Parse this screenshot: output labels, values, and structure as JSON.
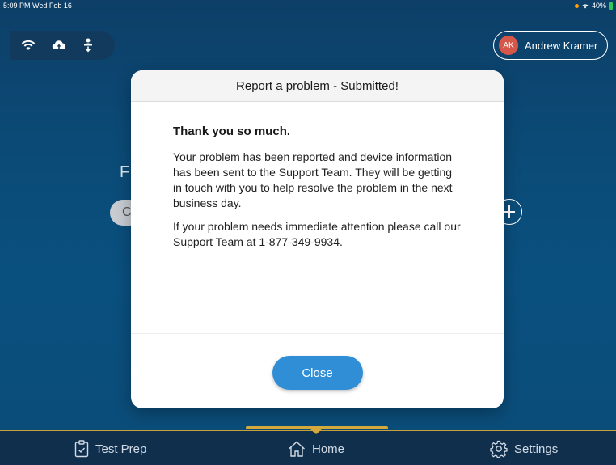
{
  "status_bar": {
    "time": "5:09 PM  Wed Feb 16",
    "battery": "40%"
  },
  "connectivity": {
    "icons": [
      "wifi-icon",
      "cloud-upload-icon",
      "person-download-icon"
    ]
  },
  "user": {
    "initials": "AK",
    "name": "Andrew Kramer",
    "avatar_color": "#d4574a"
  },
  "background": {
    "partial_letter": "F",
    "partial_button": "C"
  },
  "modal": {
    "title": "Report a problem - Submitted!",
    "heading": "Thank you so much.",
    "paragraph1": "Your problem has been reported and device information has been sent to the Support Team. They will be getting in touch with you to help resolve the problem in the next business day.",
    "paragraph2": "If your problem needs immediate attention please call our Support Team at 1-877-349-9934.",
    "close_label": "Close"
  },
  "tabbar": {
    "tabs": [
      {
        "label": "Test Prep",
        "icon": "clipboard-check-icon"
      },
      {
        "label": "Home",
        "icon": "home-icon"
      },
      {
        "label": "Settings",
        "icon": "gear-icon"
      }
    ]
  },
  "colors": {
    "accent": "#2f8ed6",
    "tab_indicator": "#d6a93c",
    "background": "#0b4a76"
  }
}
